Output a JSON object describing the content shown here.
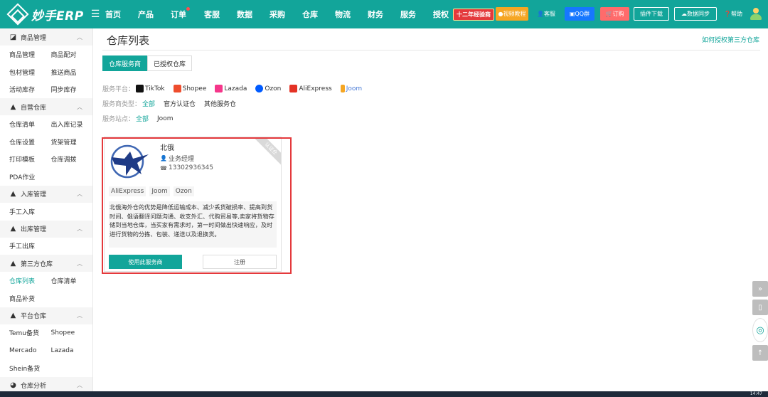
{
  "header": {
    "logo_text": "妙手ERP",
    "nav": [
      {
        "label": "首页"
      },
      {
        "label": "产品"
      },
      {
        "label": "订单",
        "dot": true
      },
      {
        "label": "客服"
      },
      {
        "label": "数据"
      },
      {
        "label": "采购"
      },
      {
        "label": "仓库"
      },
      {
        "label": "物流"
      },
      {
        "label": "财务"
      },
      {
        "label": "服务"
      },
      {
        "label": "授权"
      }
    ],
    "promo": "十二年经验商",
    "video_btn": "视频教程",
    "kefu_btn": "客服",
    "qq_btn": "QQ群",
    "order_btn": "订购",
    "plugin_btn": "插件下载",
    "sync_btn": "数据同步",
    "help_btn": "帮助"
  },
  "sidebar": {
    "sections": [
      {
        "title": "商品管理",
        "icon": "tag-icon",
        "rows": [
          [
            "商品管理",
            "商品配对"
          ],
          [
            "包材管理",
            "推送商品"
          ],
          [
            "活动库存",
            "同步库存"
          ]
        ]
      },
      {
        "title": "自营仓库",
        "icon": "warehouse-icon",
        "rows": [
          [
            "仓库清单",
            "出入库记录"
          ],
          [
            "仓库设置",
            "货架管理"
          ],
          [
            "打印模板",
            "仓库调拨"
          ],
          [
            "PDA作业",
            ""
          ]
        ]
      },
      {
        "title": "入库管理",
        "icon": "warehouse-icon",
        "rows": [
          [
            "手工入库",
            ""
          ]
        ]
      },
      {
        "title": "出库管理",
        "icon": "warehouse-icon",
        "rows": [
          [
            "手工出库",
            ""
          ]
        ]
      },
      {
        "title": "第三方仓库",
        "icon": "warehouse-icon",
        "rows": [
          [
            "仓库列表",
            "仓库清单"
          ],
          [
            "商品补货",
            ""
          ]
        ],
        "active": "仓库列表"
      },
      {
        "title": "平台仓库",
        "icon": "warehouse-icon",
        "rows": [
          [
            "Temu备货",
            "Shopee"
          ],
          [
            "Mercado",
            "Lazada"
          ],
          [
            "Shein备货",
            ""
          ]
        ]
      },
      {
        "title": "仓库分析",
        "icon": "chart-icon",
        "rows": []
      }
    ]
  },
  "main": {
    "title": "仓库列表",
    "help_link": "如何授权第三方仓库",
    "tabs": [
      {
        "label": "仓库服务商",
        "active": true
      },
      {
        "label": "已授权仓库",
        "active": false
      }
    ],
    "filters": {
      "platform_label": "服务平台：",
      "platforms": [
        "TikTok",
        "Shopee",
        "Lazada",
        "Ozon",
        "AliExpress",
        "Joom"
      ],
      "type_label": "服务商类型：",
      "types": [
        "全部",
        "官方认证仓",
        "其他服务仓"
      ],
      "site_label": "服务站点：",
      "sites": [
        "全部",
        "Joom"
      ]
    },
    "card": {
      "ribbon": "认证仓",
      "name": "北俄",
      "role": "业务经理",
      "phone": "13302936345",
      "platforms": [
        "AliExpress",
        "Joom",
        "Ozon"
      ],
      "description": "北俄海外仓的优势是降低运输成本、减少丢货破损率、提高到货时间、俄语翻译问题沟通、收支外汇、代购贸易等,卖家将货物存储到当地仓库，当买家有需求时，第一时间做出快速响应，及时进行货物的分拣、包装、递送以及退换货。",
      "use_btn": "使用此服务商",
      "register_btn": "注册"
    }
  },
  "float_tools": [
    "»",
    "▯",
    "◎",
    "↑"
  ],
  "taskbar": {
    "clock": "14:47"
  }
}
